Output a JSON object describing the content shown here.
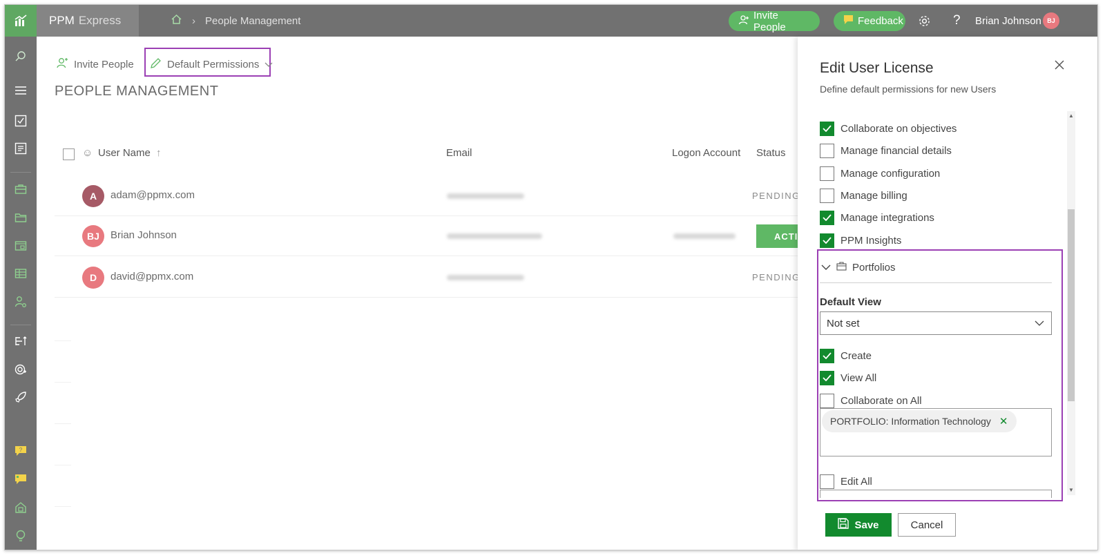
{
  "app": {
    "name": "PPM",
    "name_sub": "Express"
  },
  "breadcrumb": {
    "current": "People Management"
  },
  "header": {
    "invite_label": "Invite People",
    "feedback_label": "Feedback",
    "user_name": "Brian Johnson",
    "user_initials": "BJ"
  },
  "toolbar": {
    "invite_label": "Invite People",
    "default_permissions_label": "Default Permissions"
  },
  "page": {
    "title": "PEOPLE MANAGEMENT"
  },
  "table": {
    "columns": {
      "user_name": "User Name",
      "email": "Email",
      "logon": "Logon Account",
      "status": "Status"
    },
    "rows": [
      {
        "initials": "A",
        "name": "adam@ppmx.com",
        "status": "PENDING",
        "avatar_color": "#a65a66"
      },
      {
        "initials": "BJ",
        "name": "Brian Johnson",
        "status": "ACTIVE",
        "avatar_color": "#e8797f"
      },
      {
        "initials": "D",
        "name": "david@ppmx.com",
        "status": "PENDING",
        "avatar_color": "#e8797f"
      }
    ]
  },
  "panel": {
    "title": "Edit User License",
    "subtitle": "Define default permissions for new Users",
    "permissions": [
      {
        "label": "Collaborate on objectives",
        "checked": true
      },
      {
        "label": "Manage financial details",
        "checked": false
      },
      {
        "label": "Manage configuration",
        "checked": false
      },
      {
        "label": "Manage billing",
        "checked": false
      },
      {
        "label": "Manage integrations",
        "checked": true
      },
      {
        "label": "PPM Insights",
        "checked": true
      }
    ],
    "portfolios": {
      "section_label": "Portfolios",
      "default_view_label": "Default View",
      "default_view_value": "Not set",
      "create_label": "Create",
      "create_checked": true,
      "view_all_label": "View All",
      "view_all_checked": true,
      "collaborate_all_label": "Collaborate on All",
      "collaborate_all_checked": false,
      "tag_label": "PORTFOLIO: Information Technology",
      "edit_all_label": "Edit All",
      "edit_all_checked": false
    },
    "save_label": "Save",
    "cancel_label": "Cancel"
  },
  "colors": {
    "accent_green": "#5fb865",
    "save_green": "#128a2e",
    "highlight_purple": "#9b3fb4",
    "topbar_gray": "#717171"
  }
}
